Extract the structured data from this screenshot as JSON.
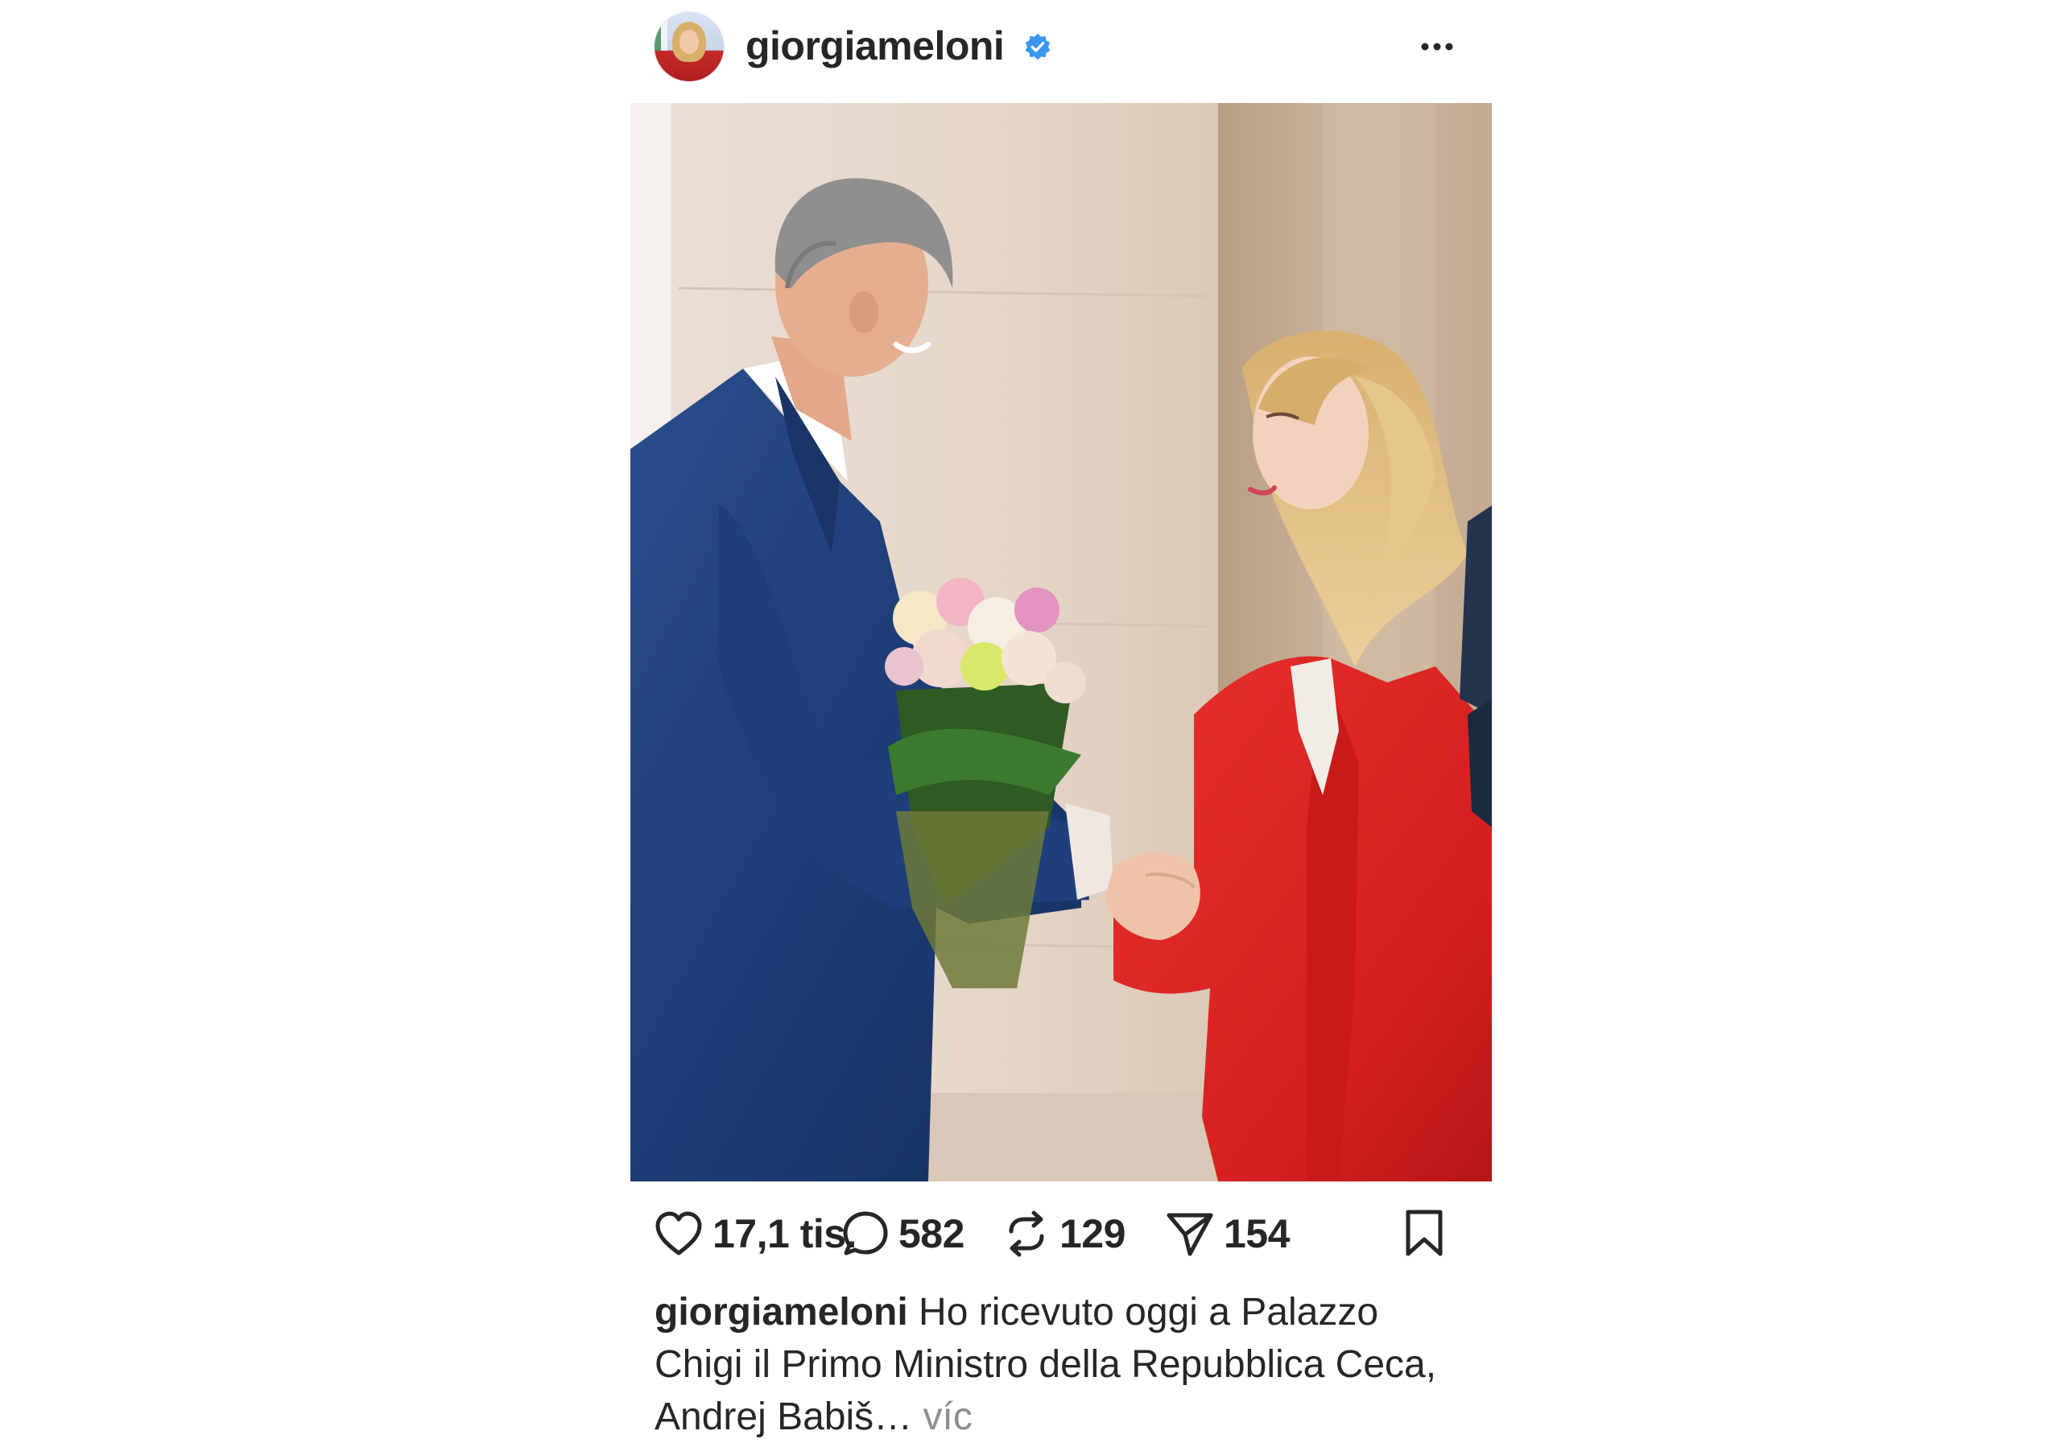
{
  "post": {
    "username": "giorgiameloni",
    "verified": true,
    "verified_color": "#3897f0",
    "icons": {
      "more": "more-horizontal-icon",
      "like": "heart-icon",
      "comment": "comment-bubble-icon",
      "repost": "repost-icon",
      "share": "send-icon",
      "save": "bookmark-icon"
    },
    "counts": {
      "likes": "17,1 tis.",
      "comments": "582",
      "reposts": "129",
      "shares": "154"
    },
    "caption": {
      "username": "giorgiameloni",
      "text": "Ho ricevuto oggi a Palazzo Chigi il Primo Ministro della Repubblica Ceca, Andrej Babiš…",
      "more_label": "víc"
    }
  }
}
